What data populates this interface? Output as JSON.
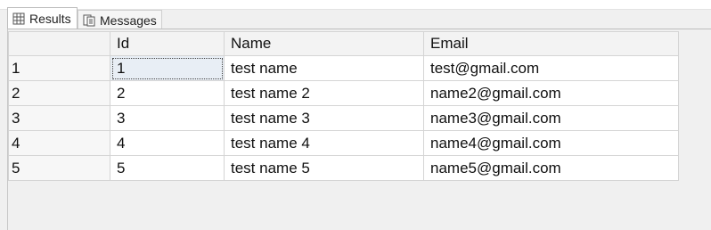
{
  "tabs": [
    {
      "label": "Results",
      "icon": "grid-icon",
      "active": true
    },
    {
      "label": "Messages",
      "icon": "messages-icon",
      "active": false
    }
  ],
  "grid": {
    "columns": [
      "",
      "Id",
      "Name",
      "Email"
    ],
    "rows": [
      {
        "num": "1",
        "id": "1",
        "name": "test name",
        "email": "test@gmail.com"
      },
      {
        "num": "2",
        "id": "2",
        "name": "test name 2",
        "email": "name2@gmail.com"
      },
      {
        "num": "3",
        "id": "3",
        "name": "test name 3",
        "email": "name3@gmail.com"
      },
      {
        "num": "4",
        "id": "4",
        "name": "test name 4",
        "email": "name4@gmail.com"
      },
      {
        "num": "5",
        "id": "5",
        "name": "test name 5",
        "email": "name5@gmail.com"
      }
    ]
  }
}
